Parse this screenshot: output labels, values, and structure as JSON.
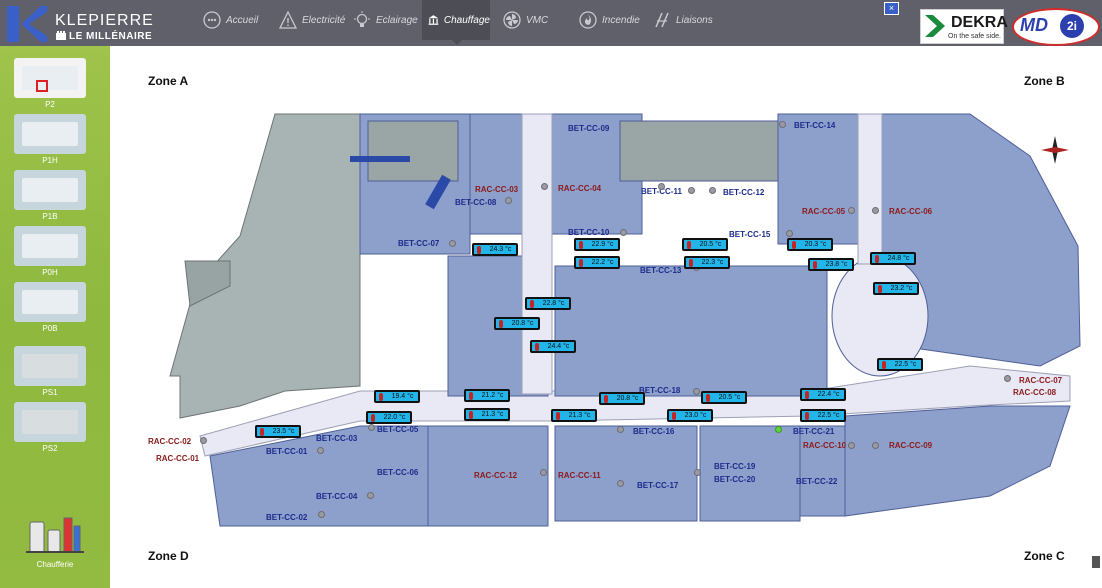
{
  "header": {
    "brand": "KLEPIERRE",
    "site": "LE MILLÉNAIRE",
    "close_glyph": "×",
    "nav": [
      {
        "label": "Accueil",
        "icon": "dots-icon"
      },
      {
        "label": "Electricité",
        "icon": "warning-icon"
      },
      {
        "label": "Eclairage",
        "icon": "bulb-icon"
      },
      {
        "label": "Chauffage",
        "icon": "columns-icon",
        "active": true
      },
      {
        "label": "VMC",
        "icon": "fan-icon"
      },
      {
        "label": "Incendie",
        "icon": "fire-icon"
      },
      {
        "label": "Liaisons",
        "icon": "link-icon"
      }
    ],
    "dekra": {
      "word": "DEKRA",
      "tagline": "On the safe side."
    },
    "md2i": {
      "md": "MD",
      "circle": "2i"
    }
  },
  "sidebar": {
    "levels": [
      "P2",
      "P1H",
      "P1B",
      "P0H",
      "P0B",
      "PS1",
      "PS2"
    ],
    "selected": "P2",
    "chaufferie": "Chaufferie"
  },
  "zones": [
    "Zone A",
    "Zone B",
    "Zone C",
    "Zone D"
  ],
  "equipment": {
    "bet": [
      "BET-CC-09",
      "BET-CC-14",
      "BET-CC-08",
      "BET-CC-11",
      "BET-CC-12",
      "BET-CC-07",
      "BET-CC-10",
      "BET-CC-15",
      "BET-CC-13",
      "BET-CC-18",
      "BET-CC-16",
      "BET-CC-21",
      "BET-CC-03",
      "BET-CC-05",
      "BET-CC-01",
      "BET-CC-06",
      "BET-CC-19",
      "BET-CC-20",
      "BET-CC-17",
      "BET-CC-22",
      "BET-CC-04",
      "BET-CC-02"
    ],
    "rac": [
      "RAC-CC-03",
      "RAC-CC-04",
      "RAC-CC-05",
      "RAC-CC-06",
      "RAC-CC-07",
      "RAC-CC-08",
      "RAC-CC-10",
      "RAC-CC-09",
      "RAC-CC-02",
      "RAC-CC-01",
      "RAC-CC-12",
      "RAC-CC-11"
    ]
  },
  "temperatures": [
    "24.3 °c",
    "22.9 °c",
    "20.5 °c",
    "20.3 °c",
    "22.2 °c",
    "22.3 °c",
    "23.8 °c",
    "24.8 °c",
    "23.2 °c",
    "22.8 °c",
    "20.8 °c",
    "24.4 °c",
    "22.5 °c",
    "21.2 °c",
    "19.4 °c",
    "20.8 °c",
    "20.5 °c",
    "22.4 °c",
    "22.0 °c",
    "21.3 °c",
    "21.3 °c",
    "23.0 °c",
    "22.5 °c",
    "23.5 °c"
  ],
  "colors": {
    "sensor_fill": "#22b5ea",
    "bet_text": "#1c2c8c",
    "rac_text": "#8b1a1a",
    "sidebar": "#9fc34b",
    "topbar": "#5f6069"
  }
}
